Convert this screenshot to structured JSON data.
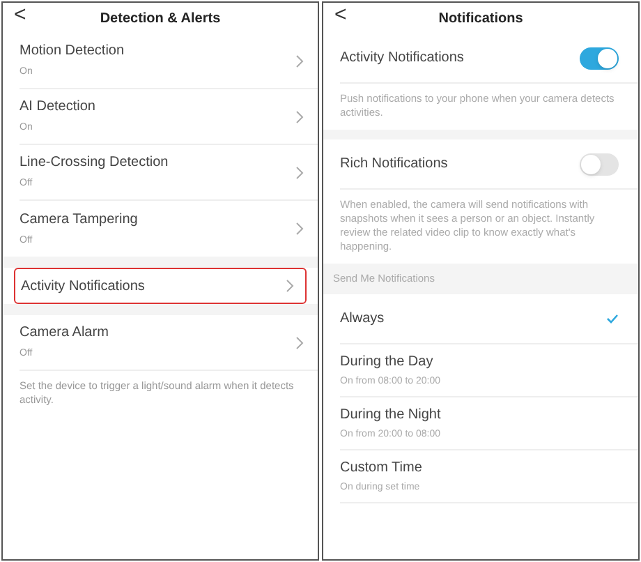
{
  "detection_screen": {
    "title": "Detection & Alerts",
    "back": "<",
    "sections": [
      {
        "items": [
          {
            "label": "Motion Detection",
            "value": "On",
            "highlighted": false
          },
          {
            "label": "AI Detection",
            "value": "On",
            "highlighted": false
          },
          {
            "label": "Line-Crossing Detection",
            "value": "Off",
            "highlighted": false
          },
          {
            "label": "Camera Tampering",
            "value": "Off",
            "highlighted": false
          }
        ]
      },
      {
        "items": [
          {
            "label": "Activity Notifications",
            "highlighted": true
          }
        ]
      },
      {
        "items": [
          {
            "label": "Camera Alarm",
            "value": "Off",
            "highlighted": false
          }
        ],
        "note": "Set the device to trigger a light/sound alarm when it detects activity."
      }
    ]
  },
  "notifications_screen": {
    "title": "Notifications",
    "back": "<",
    "toggles": [
      {
        "label": "Activity Notifications",
        "on": true,
        "note": "Push notifications to your phone when your camera detects activities."
      },
      {
        "label": "Rich Notifications",
        "on": false,
        "note": "When enabled, the camera will send notifications with snapshots when it sees a person or an object. Instantly review the related video clip to know exactly what's happening."
      }
    ],
    "options_header": "Send Me Notifications",
    "options": [
      {
        "label": "Always",
        "selected": true
      },
      {
        "label": "During the Day",
        "detail": "On from 08:00 to 20:00",
        "selected": false
      },
      {
        "label": "During the Night",
        "detail": "On from 20:00 to 08:00",
        "selected": false
      },
      {
        "label": "Custom Time",
        "detail": "On during set time",
        "selected": false
      }
    ]
  }
}
